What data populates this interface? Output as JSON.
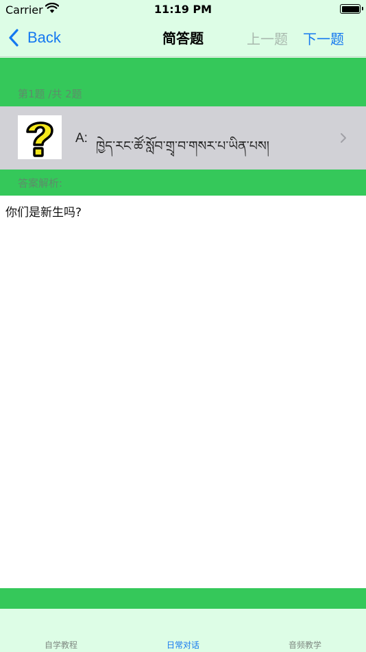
{
  "status_bar": {
    "carrier": "Carrier",
    "time": "11:19 PM"
  },
  "nav": {
    "back_label": "Back",
    "title": "简答题",
    "prev_label": "上一题",
    "next_label": "下一题"
  },
  "question": {
    "counter": "第1题 /共 2题",
    "icon": "question-mark-icon",
    "answer_prefix": "A:",
    "answer_text": "ཁྱེད་རང་ཚོ་སློབ་གྲྭ་བ་གསར་པ་ཡིན་པས།",
    "analysis_label": "答案解析:",
    "analysis_text": "你们是新生吗?"
  },
  "tabs": [
    {
      "label": "自学教程",
      "active": false
    },
    {
      "label": "日常对话",
      "active": true
    },
    {
      "label": "音频教学",
      "active": false
    }
  ],
  "colors": {
    "accent_green": "#35c85a",
    "bar_background": "#ddfde6",
    "link_blue": "#1478f0",
    "row_gray": "#d1d1d6",
    "icon_yellow": "#f4e71c"
  }
}
